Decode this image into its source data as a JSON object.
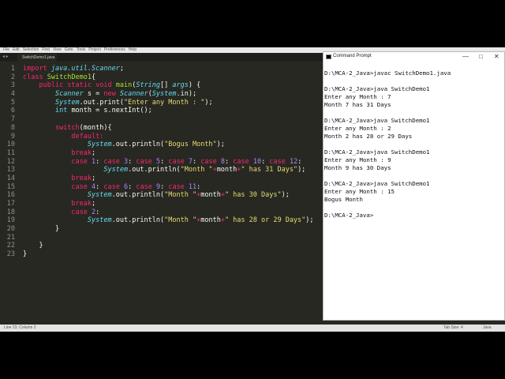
{
  "menu": [
    "File",
    "Edit",
    "Selection",
    "Find",
    "View",
    "Goto",
    "Tools",
    "Project",
    "Preferences",
    "Help"
  ],
  "tabbar": {
    "nav_glyph": "◂ ▸",
    "active_tab": "SwitchDemo1.java"
  },
  "colors": {
    "keyword": "#f92672",
    "type": "#66d9ef",
    "string": "#e6db74",
    "number": "#ae81ff",
    "function": "#a6e22e",
    "plain": "#f8f8f2",
    "editor_bg": "#272822"
  },
  "code_lines": [
    {
      "n": "1",
      "tokens": [
        {
          "t": "import ",
          "c": "keyword"
        },
        {
          "t": "java.util.Scanner",
          "c": "type"
        },
        {
          "t": ";",
          "c": "plain"
        }
      ]
    },
    {
      "n": "2",
      "tokens": [
        {
          "t": "class ",
          "c": "keyword"
        },
        {
          "t": "SwitchDemo1",
          "c": "function"
        },
        {
          "t": "{",
          "c": "plain"
        }
      ]
    },
    {
      "n": "3",
      "tokens": [
        {
          "t": "    ",
          "c": "plain"
        },
        {
          "t": "public static void ",
          "c": "keyword"
        },
        {
          "t": "main",
          "c": "function"
        },
        {
          "t": "(",
          "c": "plain"
        },
        {
          "t": "String",
          "c": "type"
        },
        {
          "t": "[] ",
          "c": "plain"
        },
        {
          "t": "args",
          "c": "type"
        },
        {
          "t": ") {",
          "c": "plain"
        }
      ]
    },
    {
      "n": "4",
      "tokens": [
        {
          "t": "        ",
          "c": "plain"
        },
        {
          "t": "Scanner",
          "c": "type"
        },
        {
          "t": " s = ",
          "c": "plain"
        },
        {
          "t": "new ",
          "c": "keyword"
        },
        {
          "t": "Scanner",
          "c": "type"
        },
        {
          "t": "(",
          "c": "plain"
        },
        {
          "t": "System",
          "c": "type"
        },
        {
          "t": ".in);",
          "c": "plain"
        }
      ]
    },
    {
      "n": "5",
      "tokens": [
        {
          "t": "        ",
          "c": "plain"
        },
        {
          "t": "System",
          "c": "type"
        },
        {
          "t": ".out.print(",
          "c": "plain"
        },
        {
          "t": "\"Enter any Month : \"",
          "c": "string"
        },
        {
          "t": ");",
          "c": "plain"
        }
      ]
    },
    {
      "n": "6",
      "tokens": [
        {
          "t": "        ",
          "c": "plain"
        },
        {
          "t": "int ",
          "c": "type"
        },
        {
          "t": "month = s.nextInt();",
          "c": "plain"
        }
      ]
    },
    {
      "n": "7",
      "tokens": []
    },
    {
      "n": "8",
      "tokens": [
        {
          "t": "        ",
          "c": "plain"
        },
        {
          "t": "switch",
          "c": "keyword"
        },
        {
          "t": "(month){",
          "c": "plain"
        }
      ]
    },
    {
      "n": "9",
      "tokens": [
        {
          "t": "            ",
          "c": "plain"
        },
        {
          "t": "default:",
          "c": "keyword"
        }
      ]
    },
    {
      "n": "10",
      "tokens": [
        {
          "t": "                ",
          "c": "plain"
        },
        {
          "t": "System",
          "c": "type"
        },
        {
          "t": ".out.println(",
          "c": "plain"
        },
        {
          "t": "\"Bogus Month\"",
          "c": "string"
        },
        {
          "t": ");",
          "c": "plain"
        }
      ]
    },
    {
      "n": "11",
      "tokens": [
        {
          "t": "            ",
          "c": "plain"
        },
        {
          "t": "break",
          "c": "keyword"
        },
        {
          "t": ";",
          "c": "plain"
        }
      ]
    },
    {
      "n": "12",
      "tokens": [
        {
          "t": "            ",
          "c": "plain"
        },
        {
          "t": "case ",
          "c": "keyword"
        },
        {
          "t": "1",
          "c": "number"
        },
        {
          "t": ": ",
          "c": "plain"
        },
        {
          "t": "case ",
          "c": "keyword"
        },
        {
          "t": "3",
          "c": "number"
        },
        {
          "t": ": ",
          "c": "plain"
        },
        {
          "t": "case ",
          "c": "keyword"
        },
        {
          "t": "5",
          "c": "number"
        },
        {
          "t": ": ",
          "c": "plain"
        },
        {
          "t": "case ",
          "c": "keyword"
        },
        {
          "t": "7",
          "c": "number"
        },
        {
          "t": ": ",
          "c": "plain"
        },
        {
          "t": "case ",
          "c": "keyword"
        },
        {
          "t": "8",
          "c": "number"
        },
        {
          "t": ": ",
          "c": "plain"
        },
        {
          "t": "case ",
          "c": "keyword"
        },
        {
          "t": "10",
          "c": "number"
        },
        {
          "t": ": ",
          "c": "plain"
        },
        {
          "t": "case ",
          "c": "keyword"
        },
        {
          "t": "12",
          "c": "number"
        },
        {
          "t": ":",
          "c": "plain"
        }
      ]
    },
    {
      "n": "13",
      "tokens": [
        {
          "t": "                    ",
          "c": "plain"
        },
        {
          "t": "System",
          "c": "type"
        },
        {
          "t": ".out.println(",
          "c": "plain"
        },
        {
          "t": "\"Month \"",
          "c": "string"
        },
        {
          "t": "+",
          "c": "keyword"
        },
        {
          "t": "month",
          "c": "plain"
        },
        {
          "t": "+",
          "c": "keyword"
        },
        {
          "t": "\" has 31 Days\"",
          "c": "string"
        },
        {
          "t": ");",
          "c": "plain"
        }
      ]
    },
    {
      "n": "14",
      "tokens": [
        {
          "t": "            ",
          "c": "plain"
        },
        {
          "t": "break",
          "c": "keyword"
        },
        {
          "t": ";",
          "c": "plain"
        }
      ]
    },
    {
      "n": "15",
      "tokens": [
        {
          "t": "            ",
          "c": "plain"
        },
        {
          "t": "case ",
          "c": "keyword"
        },
        {
          "t": "4",
          "c": "number"
        },
        {
          "t": ": ",
          "c": "plain"
        },
        {
          "t": "case ",
          "c": "keyword"
        },
        {
          "t": "6",
          "c": "number"
        },
        {
          "t": ": ",
          "c": "plain"
        },
        {
          "t": "case ",
          "c": "keyword"
        },
        {
          "t": "9",
          "c": "number"
        },
        {
          "t": ": ",
          "c": "plain"
        },
        {
          "t": "case ",
          "c": "keyword"
        },
        {
          "t": "11",
          "c": "number"
        },
        {
          "t": ":",
          "c": "plain"
        }
      ]
    },
    {
      "n": "16",
      "tokens": [
        {
          "t": "                ",
          "c": "plain"
        },
        {
          "t": "System",
          "c": "type"
        },
        {
          "t": ".out.println(",
          "c": "plain"
        },
        {
          "t": "\"Month \"",
          "c": "string"
        },
        {
          "t": "+",
          "c": "keyword"
        },
        {
          "t": "month",
          "c": "plain"
        },
        {
          "t": "+",
          "c": "keyword"
        },
        {
          "t": "\" has 30 Days\"",
          "c": "string"
        },
        {
          "t": ");",
          "c": "plain"
        }
      ]
    },
    {
      "n": "17",
      "tokens": [
        {
          "t": "            ",
          "c": "plain"
        },
        {
          "t": "break",
          "c": "keyword"
        },
        {
          "t": ";",
          "c": "plain"
        }
      ]
    },
    {
      "n": "18",
      "tokens": [
        {
          "t": "            ",
          "c": "plain"
        },
        {
          "t": "case ",
          "c": "keyword"
        },
        {
          "t": "2",
          "c": "number"
        },
        {
          "t": ":",
          "c": "plain"
        }
      ]
    },
    {
      "n": "19",
      "tokens": [
        {
          "t": "                ",
          "c": "plain"
        },
        {
          "t": "System",
          "c": "type"
        },
        {
          "t": ".out.println(",
          "c": "plain"
        },
        {
          "t": "\"Month \"",
          "c": "string"
        },
        {
          "t": "+",
          "c": "keyword"
        },
        {
          "t": "month",
          "c": "plain"
        },
        {
          "t": "+",
          "c": "keyword"
        },
        {
          "t": "\" has 28 or 29 Days\"",
          "c": "string"
        },
        {
          "t": ");",
          "c": "plain"
        }
      ]
    },
    {
      "n": "20",
      "tokens": [
        {
          "t": "        }",
          "c": "plain"
        }
      ]
    },
    {
      "n": "21",
      "tokens": []
    },
    {
      "n": "22",
      "tokens": [
        {
          "t": "    }",
          "c": "plain"
        }
      ]
    },
    {
      "n": "23",
      "tokens": [
        {
          "t": "}",
          "c": "plain"
        }
      ]
    }
  ],
  "statusbar": {
    "position": "Line 23, Column 2",
    "tab_size": "Tab Size: 4",
    "language": "Java"
  },
  "cmd": {
    "title": "Command Prompt",
    "buttons": {
      "minimize": "—",
      "maximize": "□",
      "close": "✕"
    },
    "lines": [
      "D:\\MCA-2_Java>javac SwitchDemo1.java",
      "",
      "D:\\MCA-2_Java>java SwitchDemo1",
      "Enter any Month : 7",
      "Month 7 has 31 Days",
      "",
      "D:\\MCA-2_Java>java SwitchDemo1",
      "Enter any Month : 2",
      "Month 2 has 28 or 29 Days",
      "",
      "D:\\MCA-2_Java>java SwitchDemo1",
      "Enter any Month : 9",
      "Month 9 has 30 Days",
      "",
      "D:\\MCA-2_Java>java SwitchDemo1",
      "Enter any Month : 15",
      "Bogus Month",
      "",
      "D:\\MCA-2_Java>"
    ]
  }
}
